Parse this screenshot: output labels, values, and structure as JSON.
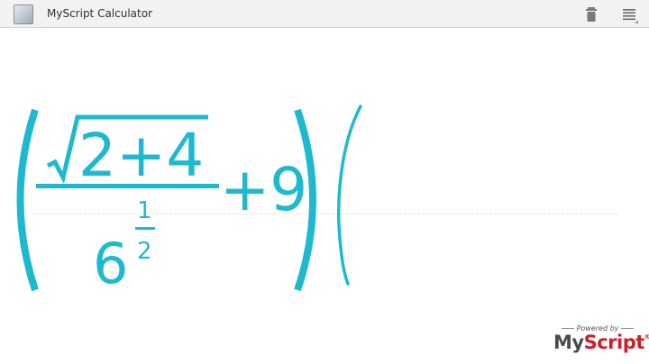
{
  "app": {
    "title": "MyScript Calculator",
    "icon": "app-icon"
  },
  "toolbar": {
    "delete_icon": "trash-icon",
    "menu_icon": "overflow-menu-icon"
  },
  "expression": {
    "radicand": "2+4",
    "denominator_base": "6",
    "exponent_numerator": "1",
    "exponent_denominator": "2",
    "addend": "+9",
    "ink_color": "#1fb9cf"
  },
  "branding": {
    "powered_by": "Powered by",
    "logo_text_my": "My",
    "logo_text_script": "Script",
    "logo_mark": "®",
    "accent_color": "#c8202a"
  }
}
